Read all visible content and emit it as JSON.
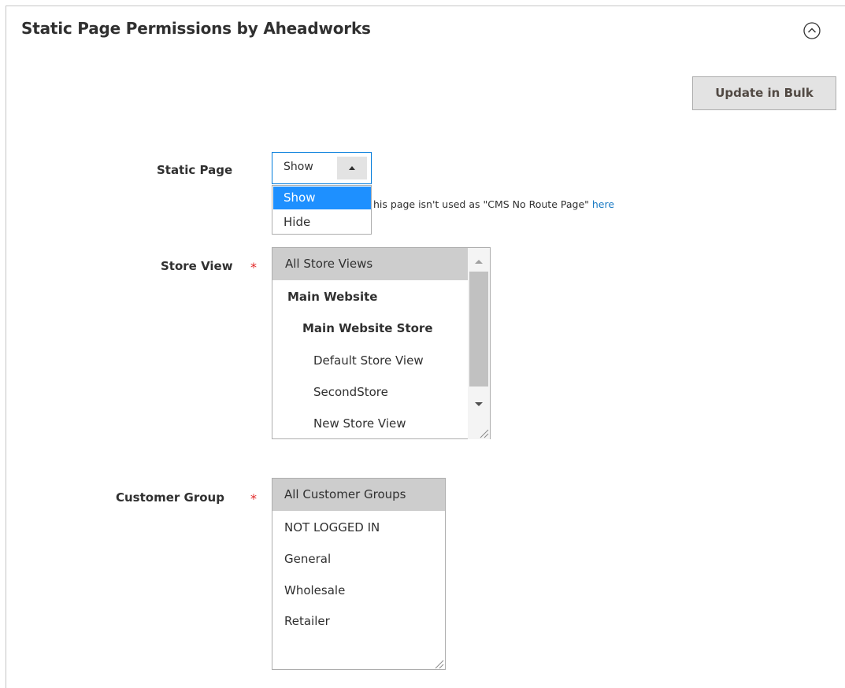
{
  "section": {
    "title": "Static Page Permissions by Aheadworks",
    "collapse_icon": "chevron-up-circle-icon"
  },
  "toolbar": {
    "update_bulk_label": "Update in Bulk"
  },
  "static_page": {
    "label": "Static Page",
    "selected": "Show",
    "options": [
      "Show",
      "Hide"
    ],
    "note_text": "his page isn't used as \"CMS No Route Page\" ",
    "note_link": "here"
  },
  "store_view": {
    "label": "Store View",
    "required_mark": "*",
    "items": [
      {
        "text": "All Store Views"
      },
      {
        "text": "Main Website"
      },
      {
        "text": "Main Website Store"
      },
      {
        "text": "Default Store View"
      },
      {
        "text": "SecondStore"
      },
      {
        "text": "New Store View"
      }
    ]
  },
  "customer_group": {
    "label": "Customer Group",
    "required_mark": "*",
    "items": [
      {
        "text": "All Customer Groups"
      },
      {
        "text": "NOT LOGGED IN"
      },
      {
        "text": "General"
      },
      {
        "text": "Wholesale"
      },
      {
        "text": "Retailer"
      }
    ]
  },
  "colors": {
    "accent": "#007bdb",
    "selected_option_bg": "#1e90ff",
    "required": "#e22626",
    "link": "#1979c3",
    "multiselect_selected_bg": "#cdcdcd"
  }
}
